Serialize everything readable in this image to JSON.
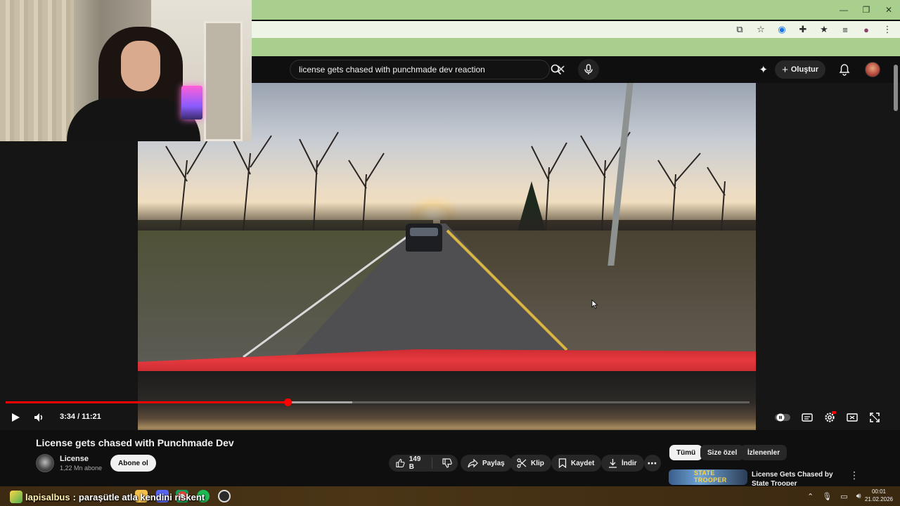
{
  "browser": {
    "window_controls": {
      "minimize": "—",
      "maximize": "❐",
      "close": "✕"
    },
    "toolbar_icons": [
      "screen-share-icon",
      "star-icon",
      "speaker-icon",
      "extensions-icon",
      "bookmarks-icon",
      "media-icon",
      "profile-icon",
      "menu-icon"
    ]
  },
  "header": {
    "search_query": "license gets chased with punchmade dev reaction",
    "clear_label": "✕",
    "create_label": "Oluştur",
    "accent": "#ff0000"
  },
  "player": {
    "time": "3:34 / 11:21",
    "progress_played": 0.3787,
    "progress_buffered": 0.466
  },
  "video": {
    "title": "License gets chased with Punchmade Dev",
    "channel": "License",
    "subscribers": "1,22 Mn abone",
    "subscribe_label": "Abone ol",
    "likes": "149 B",
    "share_label": "Paylaş",
    "clip_label": "Klip",
    "save_label": "Kaydet",
    "download_label": "İndir"
  },
  "sidebar": {
    "chips": [
      "Tümü",
      "Size özel",
      "İzlenenler"
    ],
    "recommendation": {
      "title": "License Gets Chased by State Trooper",
      "thumb_text": "STATE TROOPER"
    }
  },
  "chat": {
    "user": "lapisalbus",
    "separator": ":",
    "message": "paraşütle atla kendini riskent"
  },
  "clock": {
    "time": "00:01",
    "date": "21.02.2026"
  }
}
